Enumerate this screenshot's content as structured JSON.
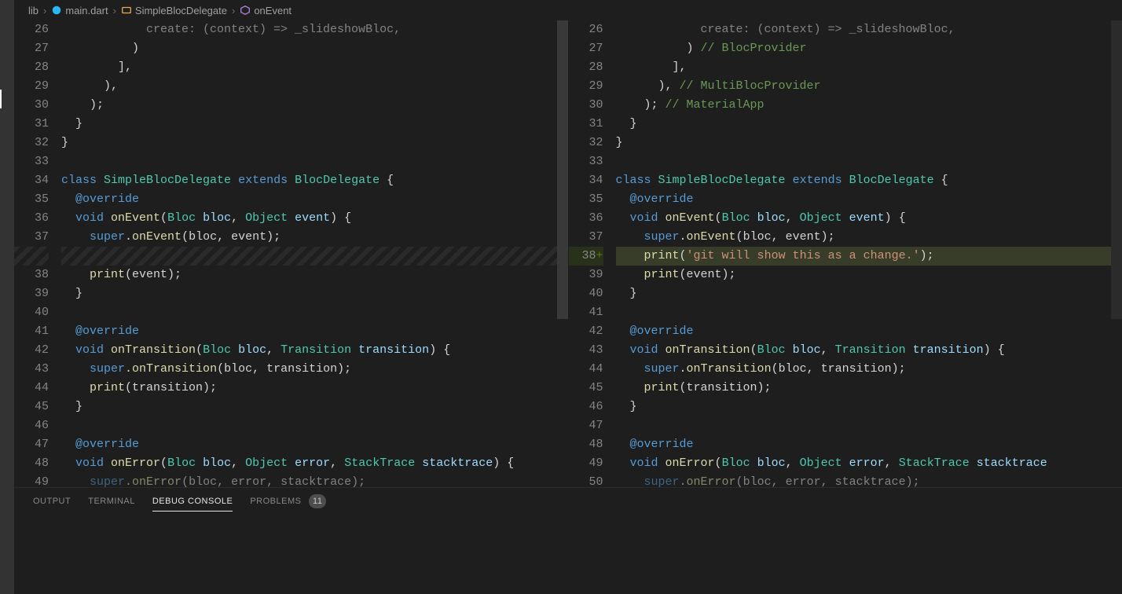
{
  "breadcrumbs": {
    "folder": "lib",
    "file": "main.dart",
    "class": "SimpleBlocDelegate",
    "method": "onEvent"
  },
  "panel": {
    "tabs": {
      "output": "OUTPUT",
      "terminal": "TERMINAL",
      "debug": "DEBUG CONSOLE",
      "problems": "PROBLEMS"
    },
    "problems_count": "11"
  },
  "left": {
    "lines": [
      {
        "n": "26",
        "tokens": [
          {
            "t": "            create: (context) => _slideshowBloc,",
            "c": "punct"
          }
        ],
        "faded": true
      },
      {
        "n": "27",
        "tokens": [
          {
            "t": "          )",
            "c": "punct"
          }
        ]
      },
      {
        "n": "28",
        "tokens": [
          {
            "t": "        ],",
            "c": "punct"
          }
        ]
      },
      {
        "n": "29",
        "tokens": [
          {
            "t": "      ),",
            "c": "punct"
          }
        ]
      },
      {
        "n": "30",
        "tokens": [
          {
            "t": "    );",
            "c": "punct"
          }
        ]
      },
      {
        "n": "31",
        "tokens": [
          {
            "t": "  }",
            "c": "punct"
          }
        ]
      },
      {
        "n": "32",
        "tokens": [
          {
            "t": "}",
            "c": "punct"
          }
        ]
      },
      {
        "n": "33",
        "tokens": [
          {
            "t": "",
            "c": ""
          }
        ]
      },
      {
        "n": "34",
        "tokens": [
          {
            "t": "class ",
            "c": "kw"
          },
          {
            "t": "SimpleBlocDelegate",
            "c": "type"
          },
          {
            "t": " ",
            "c": ""
          },
          {
            "t": "extends ",
            "c": "kw"
          },
          {
            "t": "BlocDelegate",
            "c": "type"
          },
          {
            "t": " {",
            "c": "punct"
          }
        ]
      },
      {
        "n": "35",
        "tokens": [
          {
            "t": "  ",
            "c": ""
          },
          {
            "t": "@override",
            "c": "ann"
          }
        ]
      },
      {
        "n": "36",
        "tokens": [
          {
            "t": "  ",
            "c": ""
          },
          {
            "t": "void ",
            "c": "kw"
          },
          {
            "t": "onEvent",
            "c": "fn"
          },
          {
            "t": "(",
            "c": "punct"
          },
          {
            "t": "Bloc",
            "c": "type"
          },
          {
            "t": " ",
            "c": ""
          },
          {
            "t": "bloc",
            "c": "param"
          },
          {
            "t": ", ",
            "c": "punct"
          },
          {
            "t": "Object",
            "c": "type"
          },
          {
            "t": " ",
            "c": ""
          },
          {
            "t": "event",
            "c": "param"
          },
          {
            "t": ") {",
            "c": "punct"
          }
        ]
      },
      {
        "n": "37",
        "tokens": [
          {
            "t": "    ",
            "c": ""
          },
          {
            "t": "super",
            "c": "super"
          },
          {
            "t": ".",
            "c": "punct"
          },
          {
            "t": "onEvent",
            "c": "fn"
          },
          {
            "t": "(bloc, event);",
            "c": "punct"
          }
        ]
      },
      {
        "n": "",
        "tokens": [
          {
            "t": "",
            "c": ""
          }
        ],
        "stripe": true
      },
      {
        "n": "38",
        "tokens": [
          {
            "t": "    ",
            "c": ""
          },
          {
            "t": "print",
            "c": "fn"
          },
          {
            "t": "(event);",
            "c": "punct"
          }
        ]
      },
      {
        "n": "39",
        "tokens": [
          {
            "t": "  }",
            "c": "punct"
          }
        ]
      },
      {
        "n": "40",
        "tokens": [
          {
            "t": "",
            "c": ""
          }
        ]
      },
      {
        "n": "41",
        "tokens": [
          {
            "t": "  ",
            "c": ""
          },
          {
            "t": "@override",
            "c": "ann"
          }
        ]
      },
      {
        "n": "42",
        "tokens": [
          {
            "t": "  ",
            "c": ""
          },
          {
            "t": "void ",
            "c": "kw"
          },
          {
            "t": "onTransition",
            "c": "fn"
          },
          {
            "t": "(",
            "c": "punct"
          },
          {
            "t": "Bloc",
            "c": "type"
          },
          {
            "t": " ",
            "c": ""
          },
          {
            "t": "bloc",
            "c": "param"
          },
          {
            "t": ", ",
            "c": "punct"
          },
          {
            "t": "Transition",
            "c": "type"
          },
          {
            "t": " ",
            "c": ""
          },
          {
            "t": "transition",
            "c": "param"
          },
          {
            "t": ") {",
            "c": "punct"
          }
        ]
      },
      {
        "n": "43",
        "tokens": [
          {
            "t": "    ",
            "c": ""
          },
          {
            "t": "super",
            "c": "super"
          },
          {
            "t": ".",
            "c": "punct"
          },
          {
            "t": "onTransition",
            "c": "fn"
          },
          {
            "t": "(bloc, transition);",
            "c": "punct"
          }
        ]
      },
      {
        "n": "44",
        "tokens": [
          {
            "t": "    ",
            "c": ""
          },
          {
            "t": "print",
            "c": "fn"
          },
          {
            "t": "(transition);",
            "c": "punct"
          }
        ]
      },
      {
        "n": "45",
        "tokens": [
          {
            "t": "  }",
            "c": "punct"
          }
        ]
      },
      {
        "n": "46",
        "tokens": [
          {
            "t": "",
            "c": ""
          }
        ]
      },
      {
        "n": "47",
        "tokens": [
          {
            "t": "  ",
            "c": ""
          },
          {
            "t": "@override",
            "c": "ann"
          }
        ]
      },
      {
        "n": "48",
        "tokens": [
          {
            "t": "  ",
            "c": ""
          },
          {
            "t": "void ",
            "c": "kw"
          },
          {
            "t": "onError",
            "c": "fn"
          },
          {
            "t": "(",
            "c": "punct"
          },
          {
            "t": "Bloc",
            "c": "type"
          },
          {
            "t": " ",
            "c": ""
          },
          {
            "t": "bloc",
            "c": "param"
          },
          {
            "t": ", ",
            "c": "punct"
          },
          {
            "t": "Object",
            "c": "type"
          },
          {
            "t": " ",
            "c": ""
          },
          {
            "t": "error",
            "c": "param"
          },
          {
            "t": ", ",
            "c": "punct"
          },
          {
            "t": "StackTrace",
            "c": "type"
          },
          {
            "t": " ",
            "c": ""
          },
          {
            "t": "stacktrace",
            "c": "param"
          },
          {
            "t": ") {",
            "c": "punct"
          }
        ]
      },
      {
        "n": "49",
        "tokens": [
          {
            "t": "    ",
            "c": ""
          },
          {
            "t": "super",
            "c": "super"
          },
          {
            "t": ".",
            "c": "punct"
          },
          {
            "t": "onError",
            "c": "fn"
          },
          {
            "t": "(bloc, error, stacktrace);",
            "c": "punct"
          }
        ],
        "faded": true
      }
    ]
  },
  "right": {
    "lines": [
      {
        "n": "26",
        "tokens": [
          {
            "t": "            create: (context) => _slideshowBloc,",
            "c": "punct"
          }
        ],
        "faded": true
      },
      {
        "n": "27",
        "tokens": [
          {
            "t": "          ) ",
            "c": "punct"
          },
          {
            "t": "// BlocProvider",
            "c": "comment"
          }
        ]
      },
      {
        "n": "28",
        "tokens": [
          {
            "t": "        ],",
            "c": "punct"
          }
        ]
      },
      {
        "n": "29",
        "tokens": [
          {
            "t": "      ), ",
            "c": "punct"
          },
          {
            "t": "// MultiBlocProvider",
            "c": "comment"
          }
        ]
      },
      {
        "n": "30",
        "tokens": [
          {
            "t": "    ); ",
            "c": "punct"
          },
          {
            "t": "// MaterialApp",
            "c": "comment"
          }
        ]
      },
      {
        "n": "31",
        "tokens": [
          {
            "t": "  }",
            "c": "punct"
          }
        ]
      },
      {
        "n": "32",
        "tokens": [
          {
            "t": "}",
            "c": "punct"
          }
        ]
      },
      {
        "n": "33",
        "tokens": [
          {
            "t": "",
            "c": ""
          }
        ]
      },
      {
        "n": "34",
        "tokens": [
          {
            "t": "class ",
            "c": "kw"
          },
          {
            "t": "SimpleBlocDelegate",
            "c": "type"
          },
          {
            "t": " ",
            "c": ""
          },
          {
            "t": "extends ",
            "c": "kw"
          },
          {
            "t": "BlocDelegate",
            "c": "type"
          },
          {
            "t": " {",
            "c": "punct"
          }
        ]
      },
      {
        "n": "35",
        "tokens": [
          {
            "t": "  ",
            "c": ""
          },
          {
            "t": "@override",
            "c": "ann"
          }
        ]
      },
      {
        "n": "36",
        "tokens": [
          {
            "t": "  ",
            "c": ""
          },
          {
            "t": "void ",
            "c": "kw"
          },
          {
            "t": "onEvent",
            "c": "fn"
          },
          {
            "t": "(",
            "c": "punct"
          },
          {
            "t": "Bloc",
            "c": "type"
          },
          {
            "t": " ",
            "c": ""
          },
          {
            "t": "bloc",
            "c": "param"
          },
          {
            "t": ", ",
            "c": "punct"
          },
          {
            "t": "Object",
            "c": "type"
          },
          {
            "t": " ",
            "c": ""
          },
          {
            "t": "event",
            "c": "param"
          },
          {
            "t": ") ",
            "c": "punct"
          }
        ],
        "bracket_open": true
      },
      {
        "n": "37",
        "tokens": [
          {
            "t": "    ",
            "c": ""
          },
          {
            "t": "super",
            "c": "super"
          },
          {
            "t": ".",
            "c": "punct"
          },
          {
            "t": "onEvent",
            "c": "fn"
          },
          {
            "t": "(bloc, event);",
            "c": "punct"
          }
        ]
      },
      {
        "n": "38",
        "added": true,
        "tokens": [
          {
            "t": "    ",
            "c": ""
          },
          {
            "t": "print",
            "c": "fn"
          },
          {
            "t": "(",
            "c": "punct"
          },
          {
            "t": "'git will show this as a change.'",
            "c": "str"
          },
          {
            "t": ");",
            "c": "punct"
          }
        ]
      },
      {
        "n": "39",
        "tokens": [
          {
            "t": "    ",
            "c": ""
          },
          {
            "t": "print",
            "c": "fn"
          },
          {
            "t": "(event);",
            "c": "punct"
          }
        ]
      },
      {
        "n": "40",
        "tokens": [
          {
            "t": "  ",
            "c": ""
          }
        ],
        "bracket_close": true
      },
      {
        "n": "41",
        "tokens": [
          {
            "t": "",
            "c": ""
          }
        ]
      },
      {
        "n": "42",
        "tokens": [
          {
            "t": "  ",
            "c": ""
          },
          {
            "t": "@override",
            "c": "ann"
          }
        ]
      },
      {
        "n": "43",
        "tokens": [
          {
            "t": "  ",
            "c": ""
          },
          {
            "t": "void ",
            "c": "kw"
          },
          {
            "t": "onTransition",
            "c": "fn"
          },
          {
            "t": "(",
            "c": "punct"
          },
          {
            "t": "Bloc",
            "c": "type"
          },
          {
            "t": " ",
            "c": ""
          },
          {
            "t": "bloc",
            "c": "param"
          },
          {
            "t": ", ",
            "c": "punct"
          },
          {
            "t": "Transition",
            "c": "type"
          },
          {
            "t": " ",
            "c": ""
          },
          {
            "t": "transition",
            "c": "param"
          },
          {
            "t": ") {",
            "c": "punct"
          }
        ]
      },
      {
        "n": "44",
        "tokens": [
          {
            "t": "    ",
            "c": ""
          },
          {
            "t": "super",
            "c": "super"
          },
          {
            "t": ".",
            "c": "punct"
          },
          {
            "t": "onTransition",
            "c": "fn"
          },
          {
            "t": "(bloc, transition);",
            "c": "punct"
          }
        ]
      },
      {
        "n": "45",
        "tokens": [
          {
            "t": "    ",
            "c": ""
          },
          {
            "t": "print",
            "c": "fn"
          },
          {
            "t": "(transition);",
            "c": "punct"
          }
        ]
      },
      {
        "n": "46",
        "tokens": [
          {
            "t": "  }",
            "c": "punct"
          }
        ]
      },
      {
        "n": "47",
        "tokens": [
          {
            "t": "",
            "c": ""
          }
        ]
      },
      {
        "n": "48",
        "tokens": [
          {
            "t": "  ",
            "c": ""
          },
          {
            "t": "@override",
            "c": "ann"
          }
        ]
      },
      {
        "n": "49",
        "tokens": [
          {
            "t": "  ",
            "c": ""
          },
          {
            "t": "void ",
            "c": "kw"
          },
          {
            "t": "onError",
            "c": "fn"
          },
          {
            "t": "(",
            "c": "punct"
          },
          {
            "t": "Bloc",
            "c": "type"
          },
          {
            "t": " ",
            "c": ""
          },
          {
            "t": "bloc",
            "c": "param"
          },
          {
            "t": ", ",
            "c": "punct"
          },
          {
            "t": "Object",
            "c": "type"
          },
          {
            "t": " ",
            "c": ""
          },
          {
            "t": "error",
            "c": "param"
          },
          {
            "t": ", ",
            "c": "punct"
          },
          {
            "t": "StackTrace",
            "c": "type"
          },
          {
            "t": " ",
            "c": ""
          },
          {
            "t": "stacktrace",
            "c": "param"
          }
        ]
      },
      {
        "n": "50",
        "tokens": [
          {
            "t": "    ",
            "c": ""
          },
          {
            "t": "super",
            "c": "super"
          },
          {
            "t": ".",
            "c": "punct"
          },
          {
            "t": "onError",
            "c": "fn"
          },
          {
            "t": "(bloc, error, stacktrace);",
            "c": "punct"
          }
        ],
        "faded": true
      }
    ]
  }
}
